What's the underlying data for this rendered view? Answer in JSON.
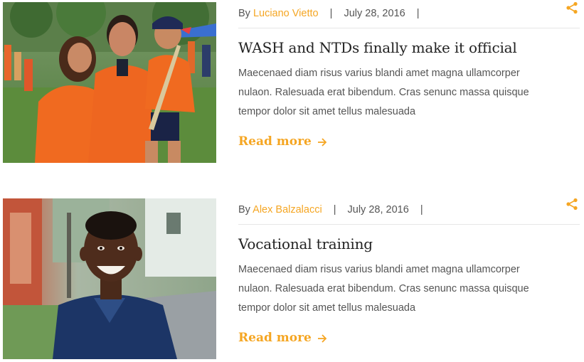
{
  "posts": [
    {
      "by_label": "By",
      "author": "Luciano Vietto",
      "date": "July 28, 2016",
      "sep": "|",
      "title": "WASH and NTDs finally make it official",
      "excerpt": "Maecenaed diam risus varius blandi amet magna ullamcorper nulaon. Ralesuada erat bibendum. Cras senunc massa quisque tempor dolor sit amet tellus malesuada",
      "read_more": "Read more",
      "image_alt": "Family in orange shirts at outdoor event"
    },
    {
      "by_label": "By",
      "author": "Alex Balzalacci",
      "date": "July 28, 2016",
      "sep": "|",
      "title": "Vocational training",
      "excerpt": "Maecenaed diam risus varius blandi amet magna ullamcorper nulaon. Ralesuada erat bibendum. Cras senunc massa quisque tempor dolor sit amet tellus malesuada",
      "read_more": "Read more",
      "image_alt": "Smiling boy in blue shirt"
    }
  ],
  "colors": {
    "accent": "#f5a623",
    "text": "#555555",
    "heading": "#222222",
    "rule": "#e6e6e6"
  },
  "icons": {
    "share": "share-icon",
    "arrow": "arrow-right-icon"
  }
}
